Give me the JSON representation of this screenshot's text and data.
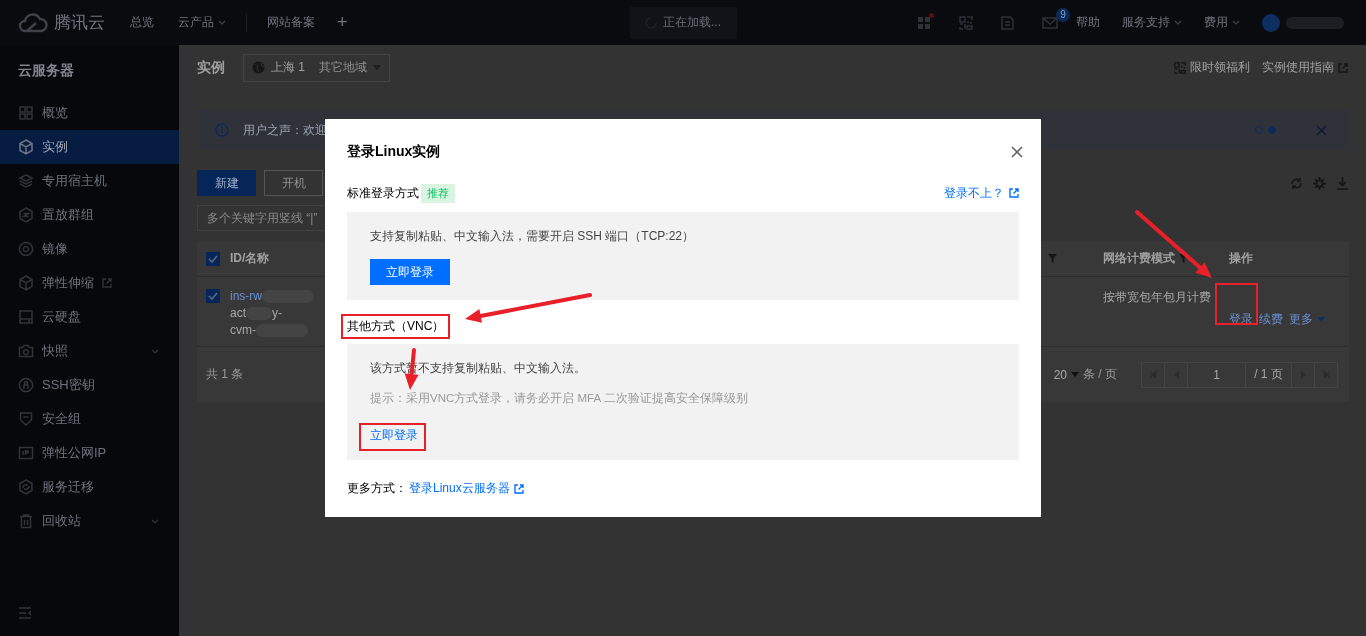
{
  "topbar": {
    "brand": "腾讯云",
    "nav": [
      {
        "label": "总览",
        "kind": "plain"
      },
      {
        "label": "云产品",
        "kind": "dropdown"
      },
      {
        "label": "网站备案",
        "kind": "plain"
      }
    ],
    "plus": "+",
    "loading": "正在加载...",
    "mail_badge": "9",
    "links": [
      {
        "label": "帮助",
        "kind": "plain"
      },
      {
        "label": "服务支持",
        "kind": "dropdown"
      },
      {
        "label": "费用",
        "kind": "dropdown"
      }
    ]
  },
  "sidebar": {
    "title": "云服务器",
    "items": [
      {
        "label": "概览",
        "kind": "plain",
        "selected": false
      },
      {
        "label": "实例",
        "kind": "plain",
        "selected": true
      },
      {
        "label": "专用宿主机",
        "kind": "plain",
        "selected": false
      },
      {
        "label": "置放群组",
        "kind": "plain",
        "selected": false
      },
      {
        "label": "镜像",
        "kind": "plain",
        "selected": false
      },
      {
        "label": "弹性伸缩",
        "kind": "external",
        "selected": false
      },
      {
        "label": "云硬盘",
        "kind": "plain",
        "selected": false
      },
      {
        "label": "快照",
        "kind": "submenu",
        "selected": false
      },
      {
        "label": "SSH密钥",
        "kind": "plain",
        "selected": false
      },
      {
        "label": "安全组",
        "kind": "plain",
        "selected": false
      },
      {
        "label": "弹性公网IP",
        "kind": "plain",
        "selected": false
      },
      {
        "label": "服务迁移",
        "kind": "plain",
        "selected": false
      },
      {
        "label": "回收站",
        "kind": "submenu",
        "selected": false
      }
    ]
  },
  "page": {
    "title": "实例",
    "region": "上海 1",
    "other_regions": "其它地域",
    "promo": "限时领福利",
    "guide": "实例使用指南"
  },
  "banner": {
    "text": "用户之声：欢迎",
    "pages": [
      {
        "selected": false
      },
      {
        "selected": true
      }
    ]
  },
  "toolbar": {
    "buttons": [
      {
        "label": "新建",
        "kind": "primary"
      },
      {
        "label": "开机",
        "kind": "default"
      }
    ],
    "search": {
      "placeholder": "多个关键字用竖线 “|”"
    }
  },
  "table": {
    "all_checked": true,
    "columns": [
      {
        "label": "ID/名称",
        "kind": "text"
      },
      {
        "kind": "filter-only"
      },
      {
        "label": "网络计费模式",
        "kind": "filter"
      },
      {
        "label": "操作",
        "kind": "text"
      }
    ],
    "rows": [
      {
        "checked": true,
        "id": "ins-rw",
        "name_lines": [
          [
            "act",
            "y-"
          ],
          [
            "cvm-"
          ]
        ],
        "billing": "按带宽包年包月计费",
        "actions": [
          {
            "label": "登录",
            "kind": "link"
          },
          {
            "label": "续费",
            "kind": "link"
          },
          {
            "label": "更多",
            "kind": "dropdown"
          }
        ]
      }
    ],
    "total": "共 1 条",
    "page_size": "20",
    "page_size_unit": "条 / 页",
    "page": "1",
    "page_total": "/ 1 页"
  },
  "modal": {
    "title": "登录Linux实例",
    "standard": {
      "label": "标准登录方式",
      "tag": "推荐",
      "help_link": "登录不上？",
      "description": "支持复制粘贴、中文输入法，需要开启 SSH 端口（TCP:22）",
      "button": "立即登录"
    },
    "other": {
      "label": "其他方式（VNC）",
      "description": "该方式暂不支持复制粘贴、中文输入法。",
      "hint": "提示：采用VNC方式登录，请务必开启 MFA 二次验证提高安全保障级别",
      "link": "立即登录"
    },
    "more_label": "更多方式：",
    "more_link": "登录Linux云服务器"
  }
}
